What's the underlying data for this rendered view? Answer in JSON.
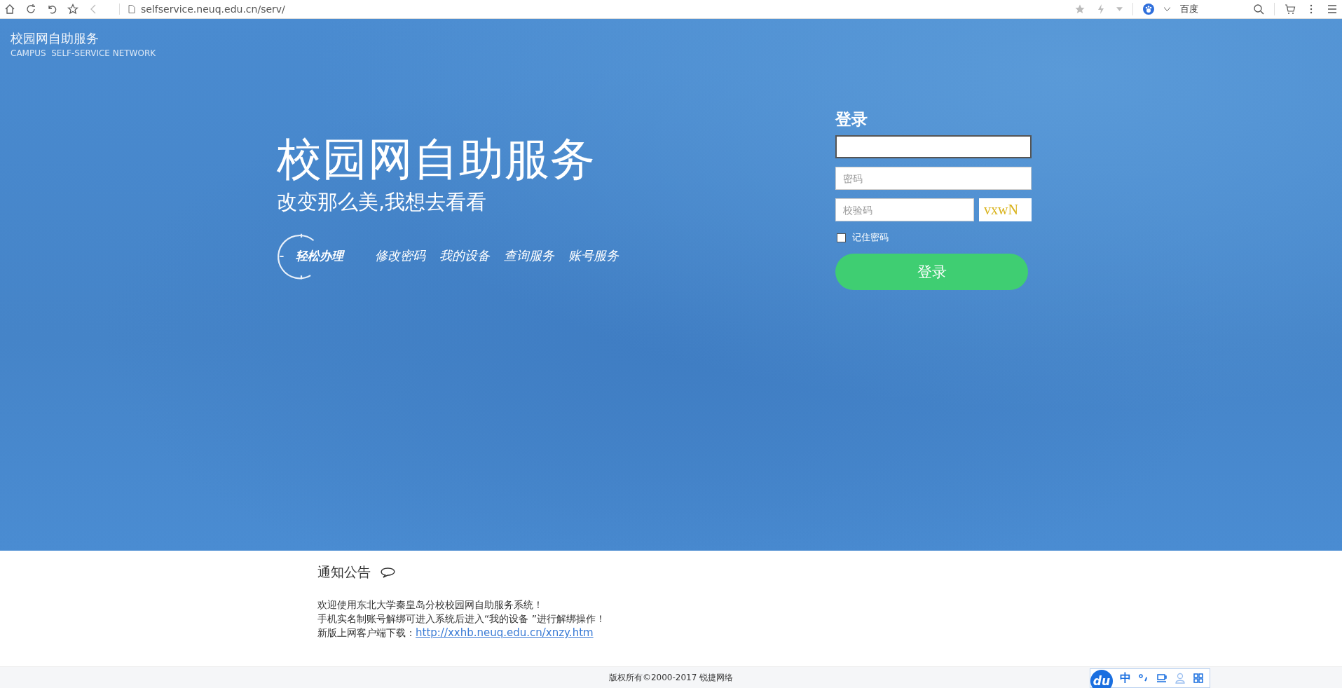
{
  "browser": {
    "url": "selfservice.neuq.edu.cn/serv/",
    "search_engine": "百度"
  },
  "header": {
    "title": "校园网自助服务",
    "subtitle": "CAMPUS  SELF-SERVICE NETWORK"
  },
  "hero": {
    "title": "校园网自助服务",
    "slogan": "改变那么美,我想去看看",
    "badge": "轻松办理",
    "links": [
      "修改密码",
      "我的设备",
      "查询服务",
      "账号服务"
    ]
  },
  "login": {
    "title": "登录",
    "password": {
      "placeholder": "密码"
    },
    "captcha": {
      "placeholder": "校验码",
      "image_text": "vxwN"
    },
    "remember": {
      "label": "记住密码",
      "checked": false
    },
    "button": "登录"
  },
  "notice": {
    "title": "通知公告",
    "lines": [
      {
        "text": "欢迎使用东北大学秦皇岛分校校园网自助服务系统！"
      },
      {
        "text": "手机实名制账号解绑可进入系统后进入“我的设备 ”进行解绑操作！"
      },
      {
        "text": "新版上网客户端下载：",
        "link": "http://xxhb.neuq.edu.cn/xnzy.htm"
      }
    ]
  },
  "footer": {
    "copyright": "版权所有©2000-2017 锐捷网络"
  },
  "ime_toolbar": {
    "logo": "du",
    "mode": "中"
  }
}
